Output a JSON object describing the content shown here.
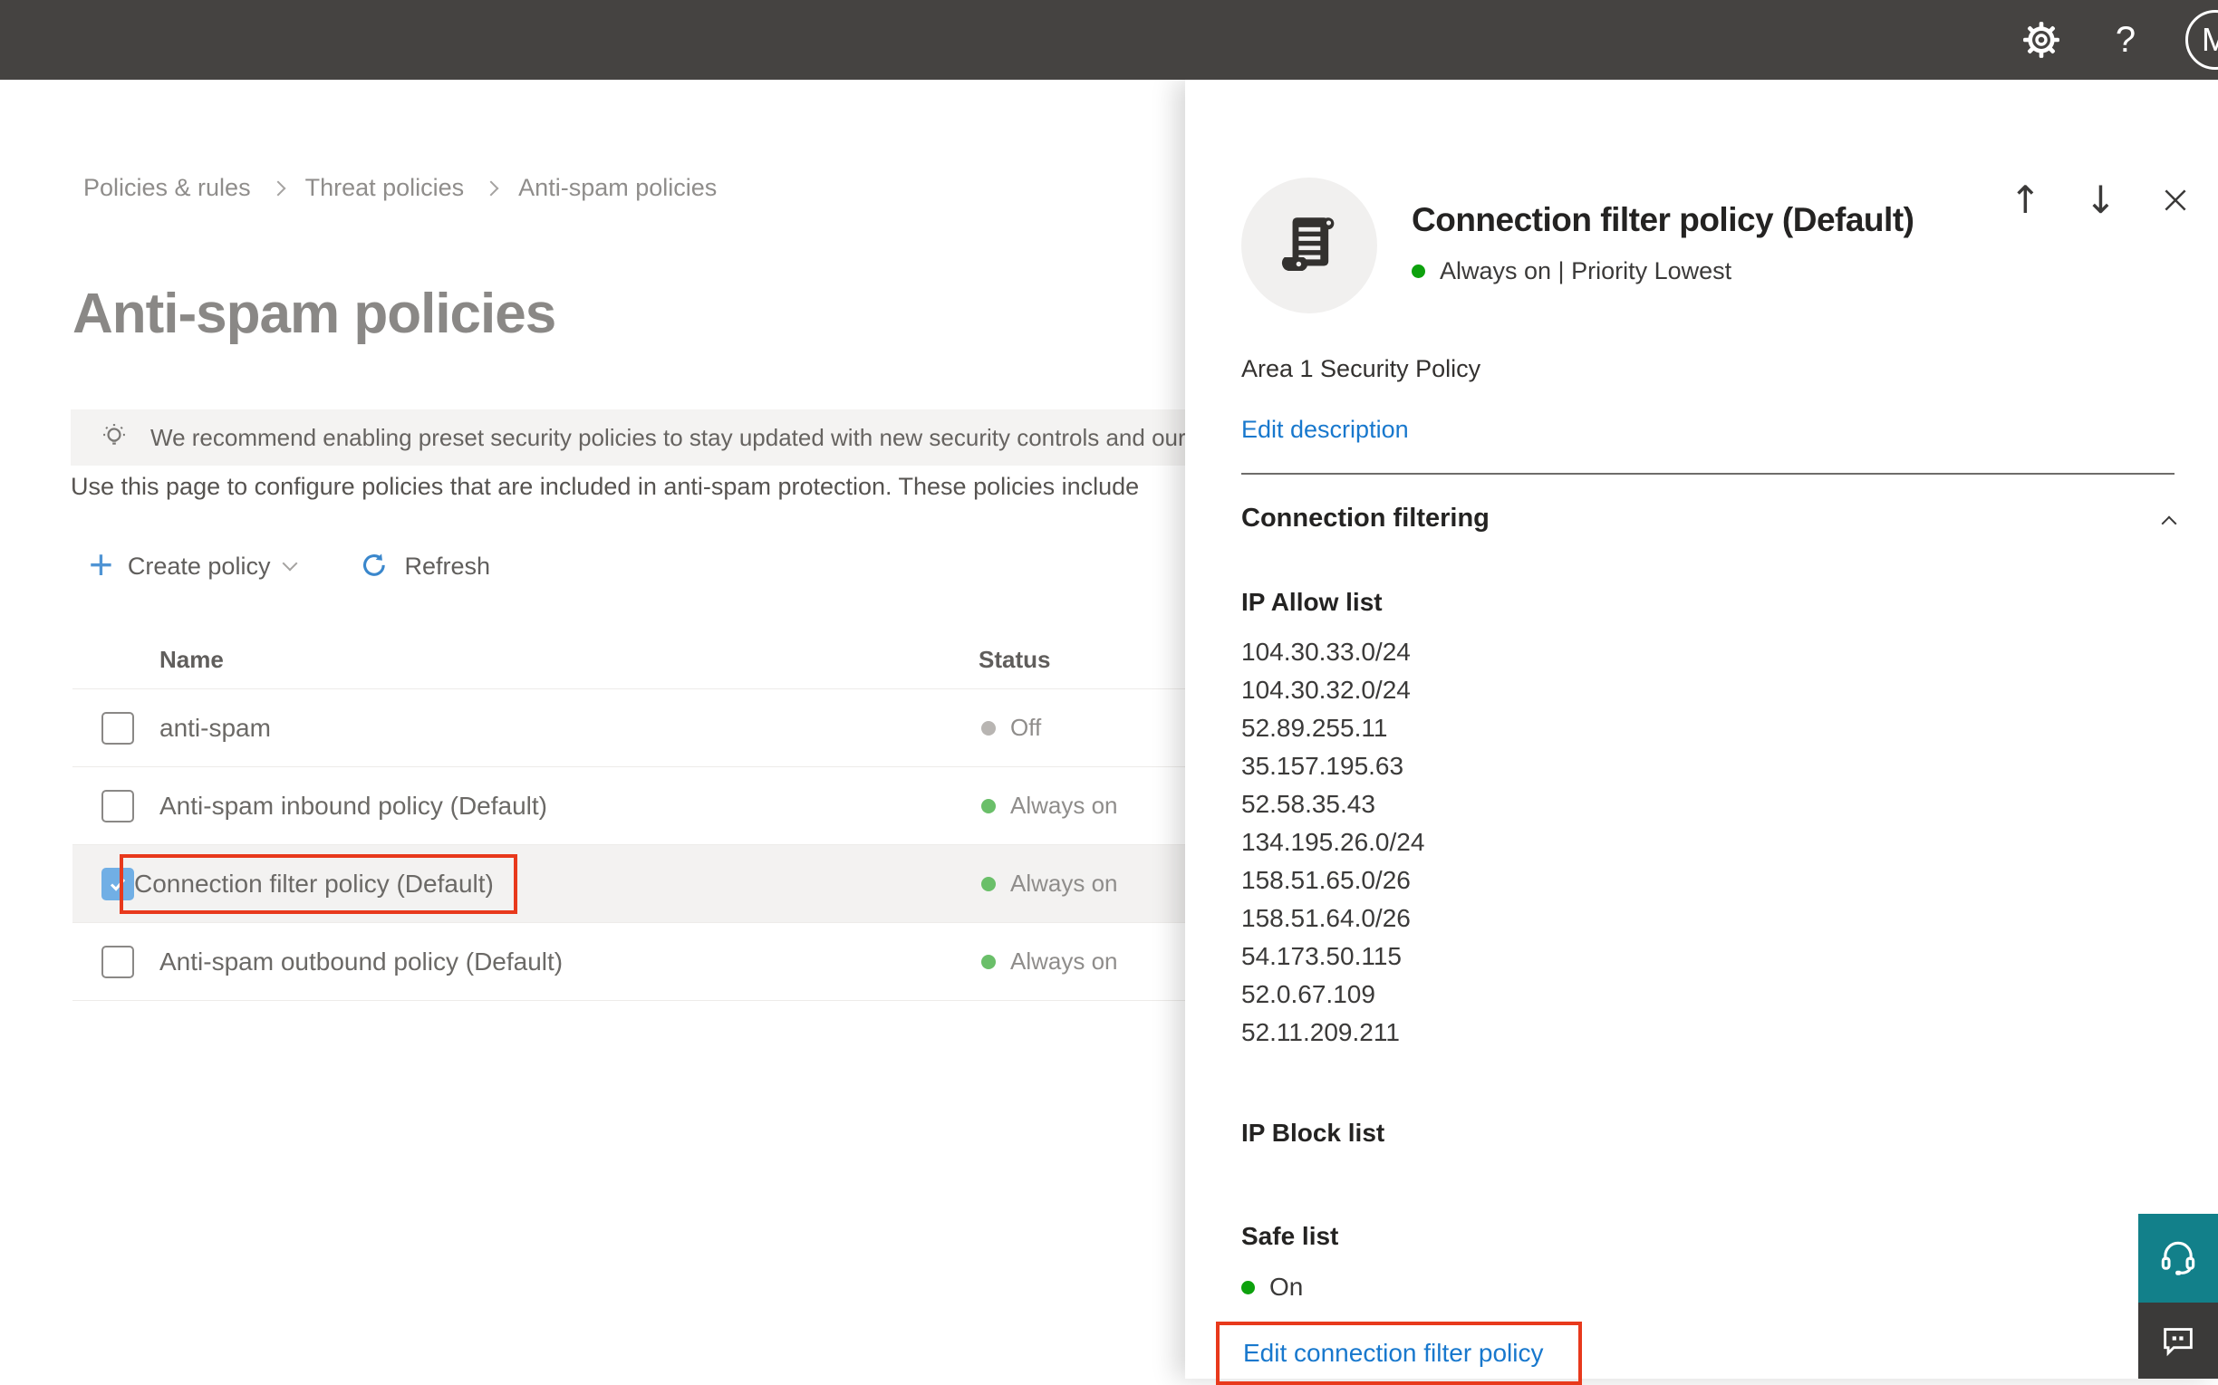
{
  "topbar": {
    "help_label": "?",
    "avatar_initial": "M"
  },
  "breadcrumb": {
    "items": [
      "Policies & rules",
      "Threat policies",
      "Anti-spam policies"
    ]
  },
  "page": {
    "title": "Anti-spam policies",
    "banner_text": "We recommend enabling preset security policies to stay updated with new security controls and our recomme",
    "intro_text": "Use this page to configure policies that are included in anti-spam protection. These policies include"
  },
  "toolbar": {
    "create_label": "Create policy",
    "refresh_label": "Refresh"
  },
  "table": {
    "header": {
      "name": "Name",
      "status": "Status"
    },
    "rows": [
      {
        "name": "anti-spam",
        "status": "Off",
        "checked": false,
        "selected": false
      },
      {
        "name": "Anti-spam inbound policy (Default)",
        "status": "Always on",
        "checked": false,
        "selected": false
      },
      {
        "name": "Connection filter policy (Default)",
        "status": "Always on",
        "checked": true,
        "selected": true
      },
      {
        "name": "Anti-spam outbound policy (Default)",
        "status": "Always on",
        "checked": false,
        "selected": false
      }
    ]
  },
  "flyout": {
    "title": "Connection filter policy (Default)",
    "status_line": "Always on | Priority Lowest",
    "description": "Area 1 Security Policy",
    "edit_description_label": "Edit description",
    "section_title": "Connection filtering",
    "ip_allow": {
      "title": "IP Allow list",
      "items": [
        "104.30.33.0/24",
        "104.30.32.0/24",
        "52.89.255.11",
        "35.157.195.63",
        "52.58.35.43",
        "134.195.26.0/24",
        "158.51.65.0/26",
        "158.51.64.0/26",
        "54.173.50.115",
        "52.0.67.109",
        "52.11.209.211"
      ]
    },
    "ip_block": {
      "title": "IP Block list"
    },
    "safe_list": {
      "title": "Safe list",
      "status": "On"
    },
    "edit_link_label": "Edit connection filter policy"
  },
  "colors": {
    "topbar_bg": "#454341",
    "link_blue": "#1878cd",
    "checkbox_blue": "#71afe5",
    "selected_row_bg": "#f3f2f1",
    "highlight_red": "#e8391c",
    "table_status_green": "#6abf69",
    "table_status_gray": "#b8b5b2",
    "flyout_status_green": "#0da10d",
    "support_teal": "#12808a",
    "feedback_dark": "#3b3a39"
  }
}
